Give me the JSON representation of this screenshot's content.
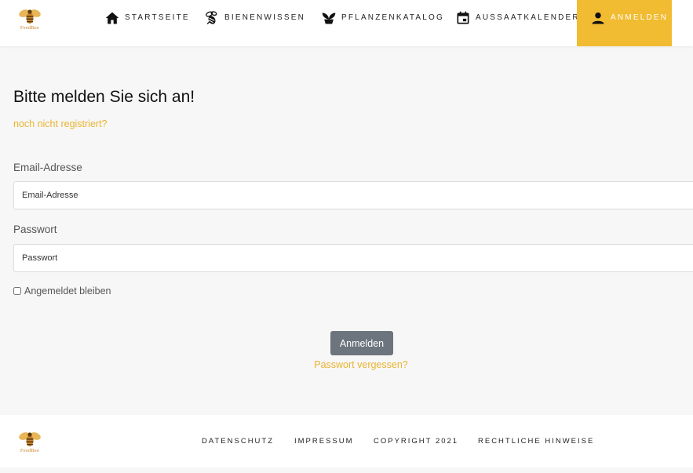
{
  "brand": {
    "name": "FeedBee",
    "accent": "#f1bc31",
    "link_color": "#e9b430"
  },
  "nav": {
    "items": [
      {
        "label": "Startseite",
        "icon": "home-icon"
      },
      {
        "label": "Bienenwissen",
        "icon": "bee-icon"
      },
      {
        "label": "Pflanzenkatalog",
        "icon": "plant-icon"
      },
      {
        "label": "Aussaatkalender",
        "icon": "calendar-icon"
      },
      {
        "label": "Anmelden",
        "icon": "person-icon",
        "active": true
      }
    ]
  },
  "login": {
    "title": "Bitte melden Sie sich an!",
    "register_link": "noch nicht registriert?",
    "email_label": "Email-Adresse",
    "email_placeholder": "Email-Adresse",
    "password_label": "Passwort",
    "password_placeholder": "Passwort",
    "remember_label": "Angemeldet bleiben",
    "remember_checked": false,
    "submit_label": "Anmelden",
    "forgot_link": "Passwort vergessen?"
  },
  "footer": {
    "links": [
      "Datenschutz",
      "Impressum",
      "Copyright 2021",
      "Rechtliche Hinweise"
    ]
  }
}
